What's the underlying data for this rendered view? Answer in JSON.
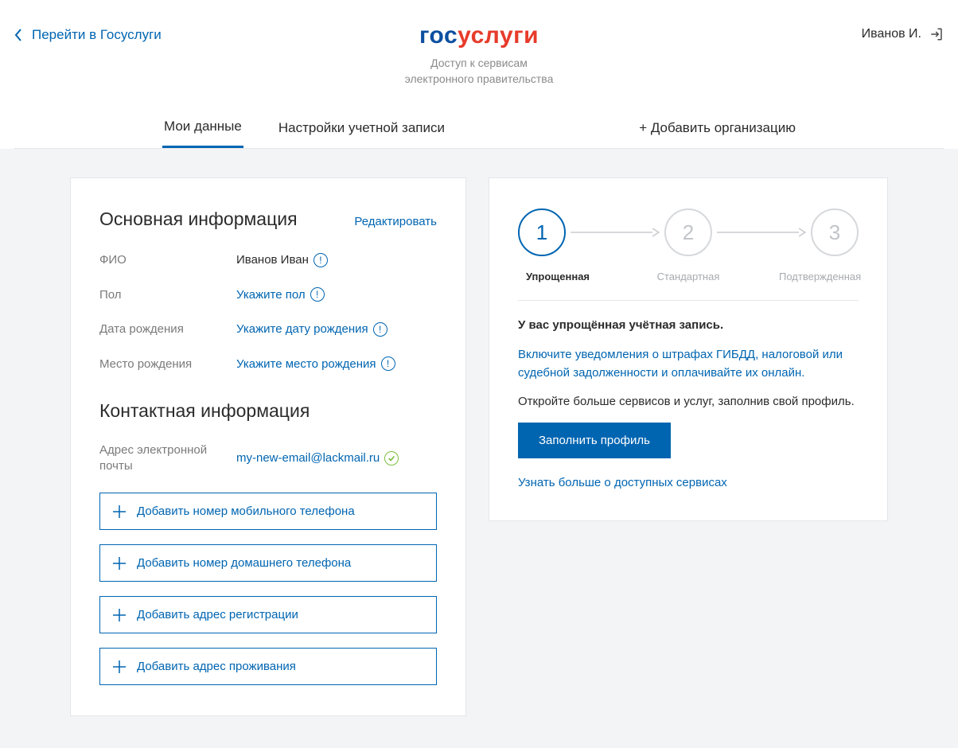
{
  "header": {
    "back_link": "Перейти в Госуслуги",
    "logo_part1": "гос",
    "logo_part2": "услуги",
    "logo_sub1": "Доступ к сервисам",
    "logo_sub2": "электронного правительства",
    "user_name": "Иванов И."
  },
  "tabs": {
    "my_data": "Мои данные",
    "settings": "Настройки учетной записи",
    "add_org": "+ Добавить организацию"
  },
  "main": {
    "basic_title": "Основная информация",
    "edit": "Редактировать",
    "fields": {
      "fio_label": "ФИО",
      "fio_value": "Иванов Иван",
      "gender_label": "Пол",
      "gender_value": "Укажите пол",
      "dob_label": "Дата рождения",
      "dob_value": "Укажите дату рождения",
      "pob_label": "Место рождения",
      "pob_value": "Укажите место рождения"
    },
    "contact_title": "Контактная информация",
    "email_label": "Адрес электронной почты",
    "email_value": "my-new-email@lackmail.ru",
    "add_buttons": {
      "mobile": "Добавить номер мобильного телефона",
      "home": "Добавить номер домашнего телефона",
      "reg": "Добавить адрес регистрации",
      "res": "Добавить адрес проживания"
    }
  },
  "side": {
    "step1": "1",
    "step2": "2",
    "step3": "3",
    "step1_label": "Упрощенная",
    "step2_label": "Стандартная",
    "step3_label": "Подтвержденная",
    "status_title": "У вас упрощённая учётная запись.",
    "text_link": "Включите уведомления о штрафах ГИБДД, налоговой или судебной задолженности и оплачивайте их онлайн.",
    "text_plain": "Откройте больше сервисов и услуг, заполнив свой профиль.",
    "btn": "Заполнить профиль",
    "more": "Узнать больше о доступных сервисах"
  }
}
